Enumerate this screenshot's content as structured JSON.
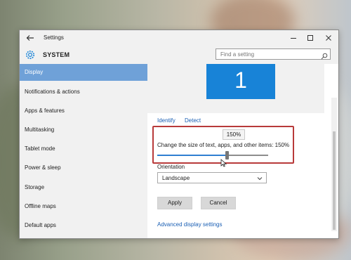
{
  "window": {
    "title": "Settings"
  },
  "header": {
    "title": "SYSTEM",
    "search_placeholder": "Find a setting"
  },
  "sidebar": {
    "items": [
      {
        "label": "Display",
        "active": true
      },
      {
        "label": "Notifications & actions"
      },
      {
        "label": "Apps & features"
      },
      {
        "label": "Multitasking"
      },
      {
        "label": "Tablet mode"
      },
      {
        "label": "Power & sleep"
      },
      {
        "label": "Storage"
      },
      {
        "label": "Offline maps"
      },
      {
        "label": "Default apps"
      }
    ]
  },
  "display": {
    "monitor_number": "1",
    "identify_label": "Identify",
    "detect_label": "Detect",
    "scale_tooltip": "150%",
    "scale_text": "Change the size of text, apps, and other items: 150%",
    "scale_slider_fraction": 0.62,
    "orientation_label": "Orientation",
    "orientation_value": "Landscape",
    "apply_label": "Apply",
    "cancel_label": "Cancel",
    "advanced_label": "Advanced display settings"
  },
  "icons": {
    "back": "back-arrow-icon",
    "settings": "gear-icon",
    "search": "search-icon",
    "dropdown": "chevron-down-icon",
    "cursor": "mouse-cursor-icon"
  },
  "colors": {
    "accent": "#1883d7",
    "sidebar_active": "#6fa1d8",
    "highlight_border": "#b83a3a",
    "link": "#1a5fb4"
  }
}
